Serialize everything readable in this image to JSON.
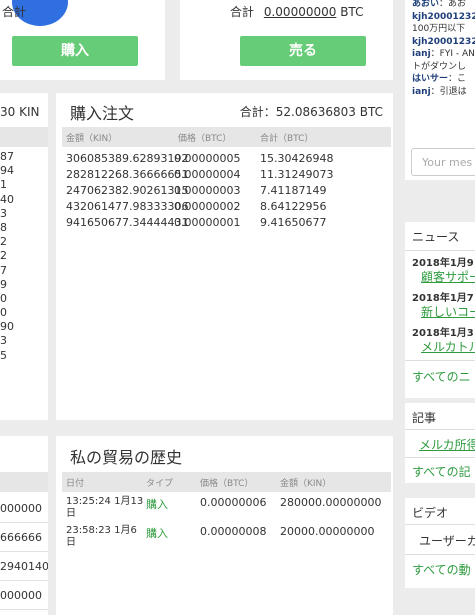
{
  "buy_form": {
    "total_label": "合計",
    "button": "購入"
  },
  "sell_form": {
    "total_label": "合計",
    "total_value": "0.00000000",
    "currency": "BTC",
    "button": "売る"
  },
  "left_sell": {
    "header_fragment": "30 KIN",
    "rows": [
      "87",
      "94",
      "1",
      "40",
      "3",
      "8",
      "2",
      "2",
      "7",
      "9",
      "0",
      "0",
      "90",
      "3",
      "5"
    ]
  },
  "buy_orders": {
    "title": "購入注文",
    "total": "合計：52.08636803 BTC",
    "columns": [
      "金額（KIN）",
      "価格（BTC）",
      "合計（BTC）"
    ],
    "rows": [
      {
        "amount": "306085389.62893192",
        "price": "0.00000005",
        "total": "15.30426948"
      },
      {
        "amount": "282812268.36666651",
        "price": "0.00000004",
        "total": "11.31249073"
      },
      {
        "amount": "247062382.90261315",
        "price": "0.00000003",
        "total": "7.41187149"
      },
      {
        "amount": "432061477.98333306",
        "price": "0.00000002",
        "total": "8.64122956"
      },
      {
        "amount": "941650677.34444431",
        "price": "0.00000001",
        "total": "9.41650677"
      }
    ]
  },
  "left_history": {
    "rows": [
      "000000",
      "666666",
      "2940140",
      "000000"
    ]
  },
  "my_trades": {
    "title": "私の貿易の歴史",
    "columns": [
      "日付",
      "タイプ",
      "価格（BTC）",
      "金額（KIN）"
    ],
    "rows": [
      {
        "date": "13:25:24 1月13日",
        "type": "購入",
        "price": "0.00000006",
        "amount": "280000.00000000"
      },
      {
        "date": "23:58:23 1月6日",
        "type": "購入",
        "price": "0.00000008",
        "amount": "20000.00000000"
      }
    ]
  },
  "chat": {
    "lines": [
      {
        "user": "あおい",
        "text": "あお"
      },
      {
        "user": "kjh20001232",
        "text": ""
      },
      {
        "user": "",
        "text": "100万円以下"
      },
      {
        "user": "kjh20001232",
        "text": ""
      },
      {
        "user": "ianj",
        "text": "FYI - AN"
      },
      {
        "user": "",
        "text": "トがダウンし"
      },
      {
        "user": "はいサー",
        "text": "こ"
      },
      {
        "user": "ianj",
        "text": "引退は"
      }
    ],
    "input_placeholder": "Your mes"
  },
  "news": {
    "title": "ニュース",
    "items": [
      {
        "date": "2018年1月9日",
        "link": "顧客サポー"
      },
      {
        "date": "2018年1月7日",
        "link": "新しいコー"
      },
      {
        "date": "2018年1月3日",
        "link": "メルカトル"
      }
    ],
    "all_link": "すべてのニ"
  },
  "articles": {
    "title": "記事",
    "item": "メルカ所得",
    "all_link": "すべての記"
  },
  "video": {
    "title": "ビデオ",
    "item": "ユーザーガ",
    "all_link": "すべての動"
  },
  "colors": {
    "accent_green": "#66cc77",
    "link_green": "#2e9b3f",
    "header_gray": "#e6e6e6",
    "avatar_blue": "#2f6fe0"
  }
}
